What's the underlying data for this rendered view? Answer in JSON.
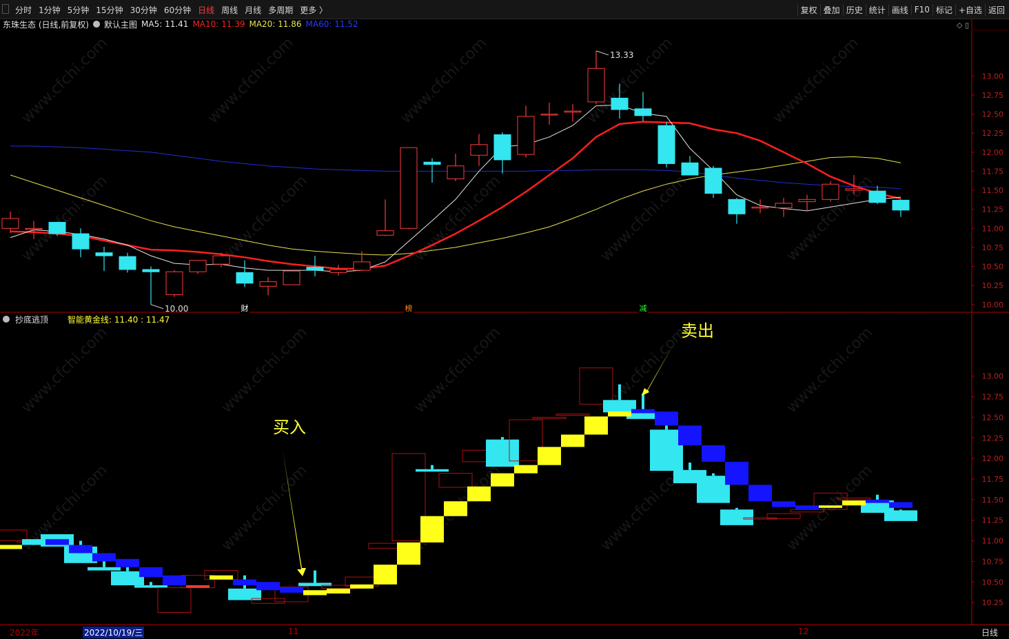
{
  "toolbar": {
    "periods": [
      "分时",
      "1分钟",
      "5分钟",
      "15分钟",
      "30分钟",
      "60分钟",
      "日线",
      "周线",
      "月线",
      "多周期",
      "更多 〉"
    ],
    "active_period": "日线",
    "right_buttons": [
      "复权",
      "叠加",
      "历史",
      "统计",
      "画线",
      "F10",
      "标记",
      "+自选",
      "返回"
    ]
  },
  "main_info": {
    "stock": "东珠生态 (日线,前复权)",
    "template": "默认主图",
    "ma5": "MA5: 11.41",
    "ma10": "MA10: 11.39",
    "ma20": "MA20: 11.86",
    "ma60": "MA60: 11.52"
  },
  "sub_info": {
    "indicator": "抄底逃顶",
    "golden_line": "智能黄金线: 11.40 : 11.47"
  },
  "colors": {
    "up": "#ff3b3b",
    "down": "#33e6f0",
    "ma5": "#e6e6e6",
    "ma10": "#ff1f1f",
    "ma20": "#e6e44a",
    "ma60": "#1f2fd6",
    "yellow_band": "#ffff1a",
    "blue_band": "#1414ff",
    "axis_border": "#b00000",
    "annotation": "#ffff33"
  },
  "chart_data": [
    {
      "type": "candlestick",
      "title": "东珠生态 (日线,前复权)",
      "y_ticks": [
        "13.00",
        "12.75",
        "12.50",
        "12.25",
        "12.00",
        "11.75",
        "11.50",
        "11.25",
        "11.00",
        "10.75",
        "10.50",
        "10.25",
        "10.00"
      ],
      "ylim": [
        9.98,
        13.6
      ],
      "candles": [
        {
          "o": 11.0,
          "h": 11.22,
          "l": 10.94,
          "c": 11.13
        },
        {
          "o": 11.0,
          "h": 11.1,
          "l": 10.86,
          "c": 11.0
        },
        {
          "o": 11.08,
          "h": 11.08,
          "l": 10.9,
          "c": 10.93
        },
        {
          "o": 10.93,
          "h": 11.0,
          "l": 10.62,
          "c": 10.73
        },
        {
          "o": 10.68,
          "h": 10.76,
          "l": 10.44,
          "c": 10.64
        },
        {
          "o": 10.63,
          "h": 10.68,
          "l": 10.42,
          "c": 10.46
        },
        {
          "o": 10.46,
          "h": 10.5,
          "l": 10.0,
          "c": 10.43
        },
        {
          "o": 10.13,
          "h": 10.45,
          "l": 10.1,
          "c": 10.43
        },
        {
          "o": 10.43,
          "h": 10.58,
          "l": 10.4,
          "c": 10.58
        },
        {
          "o": 10.53,
          "h": 10.68,
          "l": 10.49,
          "c": 10.64
        },
        {
          "o": 10.42,
          "h": 10.58,
          "l": 10.23,
          "c": 10.28
        },
        {
          "o": 10.24,
          "h": 10.36,
          "l": 10.12,
          "c": 10.3
        },
        {
          "o": 10.26,
          "h": 10.44,
          "l": 10.26,
          "c": 10.44
        },
        {
          "o": 10.49,
          "h": 10.64,
          "l": 10.37,
          "c": 10.45
        },
        {
          "o": 10.42,
          "h": 10.52,
          "l": 10.38,
          "c": 10.46
        },
        {
          "o": 10.45,
          "h": 10.7,
          "l": 10.44,
          "c": 10.56
        },
        {
          "o": 10.91,
          "h": 11.38,
          "l": 10.9,
          "c": 10.97
        },
        {
          "o": 11.0,
          "h": 12.06,
          "l": 10.99,
          "c": 12.06
        },
        {
          "o": 11.87,
          "h": 11.92,
          "l": 11.6,
          "c": 11.84
        },
        {
          "o": 11.65,
          "h": 11.98,
          "l": 11.62,
          "c": 11.82
        },
        {
          "o": 11.96,
          "h": 12.24,
          "l": 11.82,
          "c": 12.1
        },
        {
          "o": 12.23,
          "h": 12.26,
          "l": 11.72,
          "c": 11.9
        },
        {
          "o": 11.97,
          "h": 12.61,
          "l": 11.93,
          "c": 12.47
        },
        {
          "o": 12.5,
          "h": 12.65,
          "l": 12.36,
          "c": 12.5
        },
        {
          "o": 12.54,
          "h": 12.63,
          "l": 12.4,
          "c": 12.54
        },
        {
          "o": 12.66,
          "h": 13.33,
          "l": 12.63,
          "c": 13.1
        },
        {
          "o": 12.71,
          "h": 12.9,
          "l": 12.44,
          "c": 12.56
        },
        {
          "o": 12.57,
          "h": 12.79,
          "l": 12.41,
          "c": 12.48
        },
        {
          "o": 12.35,
          "h": 12.4,
          "l": 11.8,
          "c": 11.85
        },
        {
          "o": 11.86,
          "h": 11.95,
          "l": 11.7,
          "c": 11.7
        },
        {
          "o": 11.79,
          "h": 11.82,
          "l": 11.4,
          "c": 11.46
        },
        {
          "o": 11.38,
          "h": 11.4,
          "l": 11.06,
          "c": 11.19
        },
        {
          "o": 11.28,
          "h": 11.38,
          "l": 11.2,
          "c": 11.28
        },
        {
          "o": 11.27,
          "h": 11.4,
          "l": 11.15,
          "c": 11.33
        },
        {
          "o": 11.35,
          "h": 11.44,
          "l": 11.23,
          "c": 11.38
        },
        {
          "o": 11.38,
          "h": 11.62,
          "l": 11.35,
          "c": 11.58
        },
        {
          "o": 11.5,
          "h": 11.7,
          "l": 11.45,
          "c": 11.52
        },
        {
          "o": 11.49,
          "h": 11.56,
          "l": 11.32,
          "c": 11.34
        },
        {
          "o": 11.37,
          "h": 11.38,
          "l": 11.15,
          "c": 11.24
        }
      ],
      "ma_lines": {
        "ma5": [
          10.88,
          10.98,
          10.96,
          10.92,
          10.86,
          10.78,
          10.64,
          10.54,
          10.52,
          10.53,
          10.48,
          10.45,
          10.45,
          10.45,
          10.43,
          10.45,
          10.56,
          10.83,
          11.1,
          11.38,
          11.75,
          12.07,
          12.1,
          12.2,
          12.35,
          12.61,
          12.62,
          12.51,
          12.47,
          12.05,
          11.76,
          11.44,
          11.3,
          11.26,
          11.23,
          11.28,
          11.33,
          11.38,
          11.41
        ],
        "ma10": [
          10.96,
          10.95,
          10.93,
          10.9,
          10.84,
          10.78,
          10.72,
          10.71,
          10.69,
          10.66,
          10.62,
          10.57,
          10.53,
          10.5,
          10.47,
          10.47,
          10.51,
          10.64,
          10.78,
          10.93,
          11.1,
          11.28,
          11.48,
          11.7,
          11.92,
          12.2,
          12.37,
          12.4,
          12.39,
          12.38,
          12.3,
          12.25,
          12.15,
          12.0,
          11.85,
          11.68,
          11.56,
          11.46,
          11.39
        ],
        "ma20": [
          11.7,
          11.6,
          11.5,
          11.4,
          11.3,
          11.2,
          11.1,
          11.02,
          10.96,
          10.9,
          10.84,
          10.78,
          10.73,
          10.7,
          10.68,
          10.66,
          10.65,
          10.67,
          10.71,
          10.75,
          10.81,
          10.87,
          10.94,
          11.02,
          11.13,
          11.25,
          11.38,
          11.49,
          11.58,
          11.65,
          11.7,
          11.74,
          11.78,
          11.83,
          11.88,
          11.93,
          11.94,
          11.92,
          11.86
        ],
        "ma60": [
          12.08,
          12.08,
          12.07,
          12.06,
          12.04,
          12.02,
          12.0,
          11.96,
          11.92,
          11.88,
          11.85,
          11.82,
          11.8,
          11.78,
          11.77,
          11.76,
          11.75,
          11.75,
          11.75,
          11.75,
          11.75,
          11.75,
          11.75,
          11.76,
          11.76,
          11.77,
          11.77,
          11.77,
          11.76,
          11.74,
          11.7,
          11.66,
          11.63,
          11.6,
          11.58,
          11.56,
          11.55,
          11.54,
          11.52
        ]
      },
      "annotations": [
        {
          "candle": 25,
          "text": "13.33"
        },
        {
          "candle": 6,
          "text": "10.00"
        }
      ],
      "events": [
        {
          "candle": 10,
          "text": "财",
          "color": "#ffffff"
        },
        {
          "candle": 17,
          "text": "榜",
          "color": "#ff8c1a"
        },
        {
          "candle": 27,
          "text": "减",
          "color": "#2cff2c"
        }
      ]
    },
    {
      "type": "block-candles",
      "title": "抄底逃顶",
      "y_ticks": [
        "13.00",
        "12.75",
        "12.50",
        "12.25",
        "12.00",
        "11.75",
        "11.50",
        "11.25",
        "11.00",
        "10.75",
        "10.50",
        "10.25"
      ],
      "ylim": [
        10.0,
        13.6
      ],
      "bands": [
        {
          "lo": 10.9,
          "hi": 10.95,
          "c": "y"
        },
        {
          "lo": 10.95,
          "hi": 11.02,
          "c": "c"
        },
        {
          "lo": 10.95,
          "hi": 11.02,
          "c": "b"
        },
        {
          "lo": 10.85,
          "hi": 10.95,
          "c": "b"
        },
        {
          "lo": 10.75,
          "hi": 10.85,
          "c": "b"
        },
        {
          "lo": 10.68,
          "hi": 10.78,
          "c": "b"
        },
        {
          "lo": 10.56,
          "hi": 10.68,
          "c": "b"
        },
        {
          "lo": 10.46,
          "hi": 10.58,
          "c": "b"
        },
        {
          "lo": 10.43,
          "hi": 10.46,
          "c": "r"
        },
        {
          "lo": 10.53,
          "hi": 10.58,
          "c": "y"
        },
        {
          "lo": 10.46,
          "hi": 10.53,
          "c": "b"
        },
        {
          "lo": 10.4,
          "hi": 10.5,
          "c": "b"
        },
        {
          "lo": 10.37,
          "hi": 10.44,
          "c": "b"
        },
        {
          "lo": 10.34,
          "hi": 10.4,
          "c": "y"
        },
        {
          "lo": 10.36,
          "hi": 10.42,
          "c": "y"
        },
        {
          "lo": 10.42,
          "hi": 10.47,
          "c": "y"
        },
        {
          "lo": 10.47,
          "hi": 10.71,
          "c": "y"
        },
        {
          "lo": 10.71,
          "hi": 10.98,
          "c": "y"
        },
        {
          "lo": 10.98,
          "hi": 11.3,
          "c": "y"
        },
        {
          "lo": 11.3,
          "hi": 11.48,
          "c": "y"
        },
        {
          "lo": 11.48,
          "hi": 11.66,
          "c": "y"
        },
        {
          "lo": 11.66,
          "hi": 11.82,
          "c": "y"
        },
        {
          "lo": 11.82,
          "hi": 11.92,
          "c": "y"
        },
        {
          "lo": 11.92,
          "hi": 12.14,
          "c": "y"
        },
        {
          "lo": 12.14,
          "hi": 12.29,
          "c": "y"
        },
        {
          "lo": 12.29,
          "hi": 12.51,
          "c": "y"
        },
        {
          "lo": 12.51,
          "hi": 12.57,
          "c": "y"
        },
        {
          "lo": 12.55,
          "hi": 12.6,
          "c": "b"
        },
        {
          "lo": 12.4,
          "hi": 12.57,
          "c": "b"
        },
        {
          "lo": 12.16,
          "hi": 12.4,
          "c": "b"
        },
        {
          "lo": 11.96,
          "hi": 12.16,
          "c": "b"
        },
        {
          "lo": 11.68,
          "hi": 11.96,
          "c": "b"
        },
        {
          "lo": 11.48,
          "hi": 11.68,
          "c": "b"
        },
        {
          "lo": 11.41,
          "hi": 11.48,
          "c": "b"
        },
        {
          "lo": 11.38,
          "hi": 11.43,
          "c": "b"
        },
        {
          "lo": 11.4,
          "hi": 11.43,
          "c": "y"
        },
        {
          "lo": 11.43,
          "hi": 11.49,
          "c": "y"
        },
        {
          "lo": 11.46,
          "hi": 11.5,
          "c": "b"
        },
        {
          "lo": 11.4,
          "hi": 11.47,
          "c": "b"
        }
      ],
      "dates": [
        "2022年",
        "2022/10/19/三",
        "11",
        "12"
      ],
      "period_label": "日线"
    }
  ],
  "signals": {
    "buy": "买入",
    "sell": "卖出"
  },
  "watermark": "www.cfchi.com"
}
